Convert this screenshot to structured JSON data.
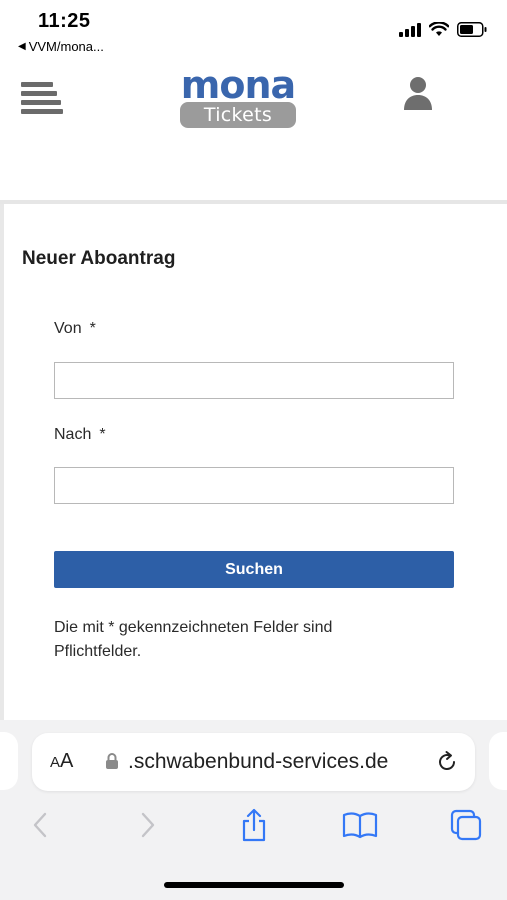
{
  "status_bar": {
    "time": "11:25",
    "back_label": "VVM/mona..."
  },
  "header": {
    "logo_word": "mona",
    "logo_sub": "Tickets",
    "brand_color": "#3a66ad"
  },
  "form": {
    "title": "Neuer Aboantrag",
    "from_label": "Von",
    "from_required": "*",
    "from_value": "",
    "to_label": "Nach",
    "to_required": "*",
    "to_value": "",
    "search_button": "Suchen",
    "hint": "Die mit * gekennzeichneten Felder sind Pflichtfelder.",
    "button_color": "#2d5fa7"
  },
  "browser": {
    "aa_label_small": "A",
    "aa_label_big": "A",
    "url": ".schwabenbund-services.de",
    "toolbar": [
      "back-icon",
      "forward-icon",
      "share-icon",
      "bookmarks-icon",
      "tabs-icon"
    ]
  }
}
